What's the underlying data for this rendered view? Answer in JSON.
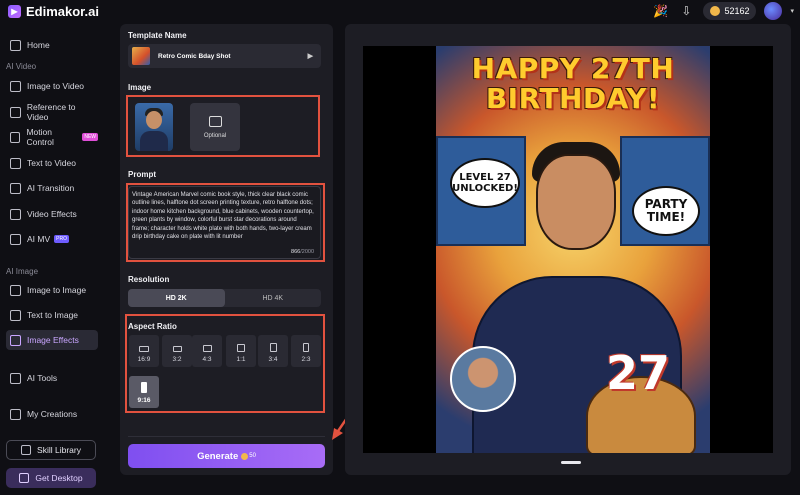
{
  "app": {
    "name": "Edimakor.ai",
    "credits": "52162"
  },
  "sidebar": {
    "home": "Home",
    "section_video": "AI Video",
    "video_items": [
      {
        "label": "Image to Video"
      },
      {
        "label": "Reference to Video"
      },
      {
        "label": "Motion Control",
        "badge": "NEW"
      },
      {
        "label": "Text to Video"
      },
      {
        "label": "AI Transition"
      },
      {
        "label": "Video Effects"
      },
      {
        "label": "AI MV",
        "badge": "PRO"
      }
    ],
    "section_image": "AI Image",
    "image_items": [
      {
        "label": "Image to Image"
      },
      {
        "label": "Text to Image"
      },
      {
        "label": "Image Effects"
      }
    ],
    "ai_tools": "AI Tools",
    "my_creations": "My Creations",
    "skill_library": "Skill Library",
    "get_desktop": "Get Desktop"
  },
  "panel": {
    "template_label": "Template Name",
    "template_value": "Retro Comic Bday Shot",
    "image_label": "Image",
    "optional_label": "Optional",
    "prompt_label": "Prompt",
    "prompt_text": "Vintage American Marvel comic book style, thick clear black comic outline lines, halftone dot screen printing texture, retro halftone dots; indoor home kitchen background, blue cabinets, wooden countertop, green plants by window, colorful burst star decorations around frame; character holds white plate with both hands, two-layer cream drip birthday cake on plate with lit number",
    "prompt_count": "866",
    "prompt_max": "/2000",
    "resolution_label": "Resolution",
    "resolution_options": [
      "HD 2K",
      "HD 4K"
    ],
    "aspect_label": "Aspect Ratio",
    "aspect_options": [
      "16:9",
      "3:2",
      "4:3",
      "1:1",
      "3:4",
      "2:3",
      "9:16"
    ],
    "aspect_selected": "9:16",
    "generate_label": "Generate",
    "generate_cost": "50"
  },
  "preview": {
    "title_line1": "HAPPY 27TH",
    "title_line2": "BIRTHDAY!",
    "bubble1": "LEVEL 27 UNLOCKED!",
    "bubble2": "PARTY TIME!",
    "cake_number": "27"
  },
  "colors": {
    "accent": "#8a5cff",
    "highlight_box": "#e2523f",
    "panel_bg": "#1d1d24",
    "page_bg": "#0f0f14"
  }
}
